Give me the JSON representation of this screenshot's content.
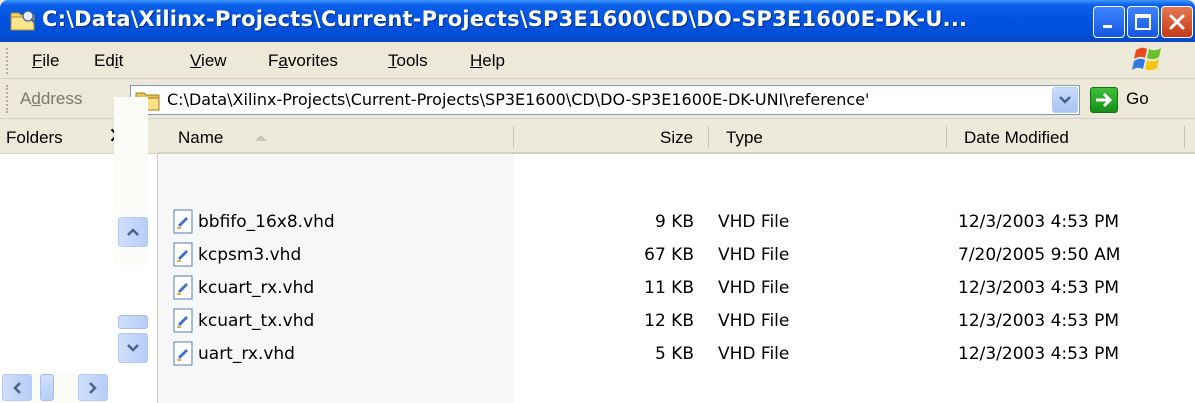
{
  "window": {
    "title": "C:\\Data\\Xilinx-Projects\\Current-Projects\\SP3E1600\\CD\\DO-SP3E1600E-DK-U..."
  },
  "menu": [
    {
      "pre": "",
      "ul": "F",
      "post": "ile"
    },
    {
      "pre": "Ed",
      "ul": "i",
      "post": "t"
    },
    {
      "pre": "",
      "ul": "V",
      "post": "iew"
    },
    {
      "pre": "F",
      "ul": "a",
      "post": "vorites"
    },
    {
      "pre": "",
      "ul": "T",
      "post": "ools"
    },
    {
      "pre": "",
      "ul": "H",
      "post": "elp"
    }
  ],
  "address": {
    "label_pre": "A",
    "label_ul": "d",
    "label_post": "dress",
    "path": "C:\\Data\\Xilinx-Projects\\Current-Projects\\SP3E1600\\CD\\DO-SP3E1600E-DK-UNI\\reference'",
    "go_label": "Go"
  },
  "folders_pane": {
    "title": "Folders",
    "close_symbol": "✕"
  },
  "columns": {
    "name": "Name",
    "size": "Size",
    "type": "Type",
    "date": "Date Modified"
  },
  "files": [
    {
      "name": "bbfifo_16x8.vhd",
      "size": "9 KB",
      "type": "VHD File",
      "date": "12/3/2003 4:53 PM"
    },
    {
      "name": "kcpsm3.vhd",
      "size": "67 KB",
      "type": "VHD File",
      "date": "7/20/2005 9:50 AM"
    },
    {
      "name": "kcuart_rx.vhd",
      "size": "11 KB",
      "type": "VHD File",
      "date": "12/3/2003 4:53 PM"
    },
    {
      "name": "kcuart_tx.vhd",
      "size": "12 KB",
      "type": "VHD File",
      "date": "12/3/2003 4:53 PM"
    },
    {
      "name": "uart_rx.vhd",
      "size": "5 KB",
      "type": "VHD File",
      "date": "12/3/2003 4:53 PM"
    }
  ],
  "icons": {
    "title": "folder-explorer-icon",
    "file": "vhd-file-icon",
    "sort": "sort-ascending-icon"
  },
  "colors": {
    "titlebar": "#0053e1",
    "close_button": "#c43a16",
    "name_column_bg": "#f7f7f7"
  }
}
